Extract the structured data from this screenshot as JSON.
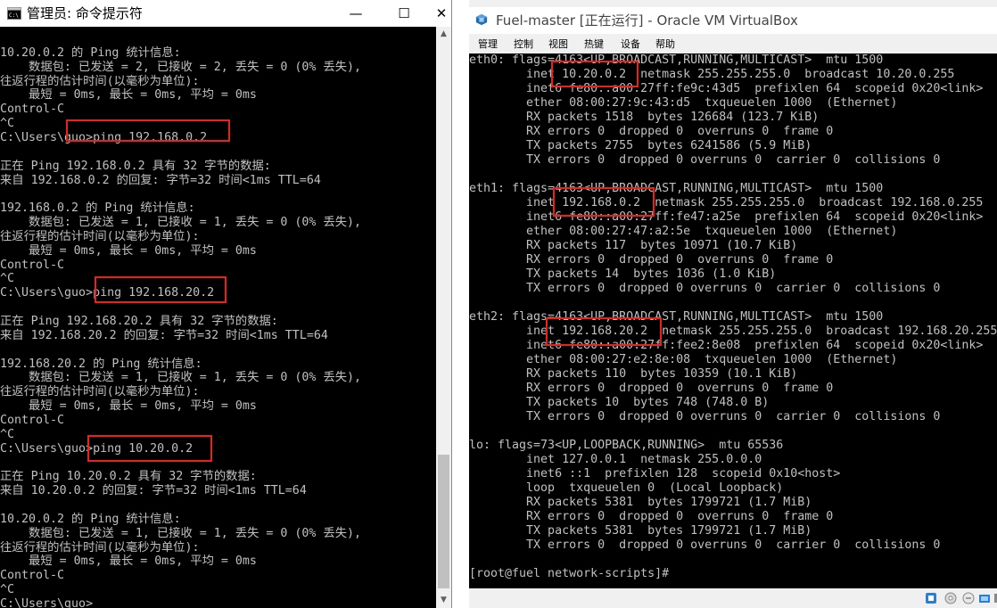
{
  "cmd_window": {
    "title": "管理员: 命令提示符",
    "icon": "cmd-icon",
    "controls": {
      "minimize": "—",
      "maximize": "☐",
      "close": "✕"
    },
    "lines": [
      "",
      "10.20.0.2 的 Ping 统计信息:",
      "    数据包: 已发送 = 2, 已接收 = 2, 丢失 = 0 (0% 丢失),",
      "往返行程的估计时间(以毫秒为单位):",
      "    最短 = 0ms, 最长 = 0ms, 平均 = 0ms",
      "Control-C",
      "^C",
      "C:\\Users\\guo>ping 192.168.0.2",
      "",
      "正在 Ping 192.168.0.2 具有 32 字节的数据:",
      "来自 192.168.0.2 的回复: 字节=32 时间<1ms TTL=64",
      "",
      "192.168.0.2 的 Ping 统计信息:",
      "    数据包: 已发送 = 1, 已接收 = 1, 丢失 = 0 (0% 丢失),",
      "往返行程的估计时间(以毫秒为单位):",
      "    最短 = 0ms, 最长 = 0ms, 平均 = 0ms",
      "Control-C",
      "^C",
      "C:\\Users\\guo>ping 192.168.20.2",
      "",
      "正在 Ping 192.168.20.2 具有 32 字节的数据:",
      "来自 192.168.20.2 的回复: 字节=32 时间<1ms TTL=64",
      "",
      "192.168.20.2 的 Ping 统计信息:",
      "    数据包: 已发送 = 1, 已接收 = 1, 丢失 = 0 (0% 丢失),",
      "往返行程的估计时间(以毫秒为单位):",
      "    最短 = 0ms, 最长 = 0ms, 平均 = 0ms",
      "Control-C",
      "^C",
      "C:\\Users\\guo>ping 10.20.0.2",
      "",
      "正在 Ping 10.20.0.2 具有 32 字节的数据:",
      "来自 10.20.0.2 的回复: 字节=32 时间<1ms TTL=64",
      "",
      "10.20.0.2 的 Ping 统计信息:",
      "    数据包: 已发送 = 1, 已接收 = 1, 丢失 = 0 (0% 丢失),",
      "往返行程的估计时间(以毫秒为单位):",
      "    最短 = 0ms, 最长 = 0ms, 平均 = 0ms",
      "Control-C",
      "^C",
      "C:\\Users\\guo>"
    ]
  },
  "vbox_window": {
    "title": "Fuel-master [正在运行] - Oracle VM VirtualBox",
    "icon": "virtualbox-icon",
    "controls": {
      "minimize": "—",
      "maximize": "☐",
      "close": "✕"
    },
    "menu": [
      "管理",
      "控制",
      "视图",
      "热键",
      "设备",
      "帮助"
    ],
    "lines": [
      "eth0: flags=4163<UP,BROADCAST,RUNNING,MULTICAST>  mtu 1500",
      "        inet 10.20.0.2  netmask 255.255.255.0  broadcast 10.20.0.255",
      "        inet6 fe80::a00:27ff:fe9c:43d5  prefixlen 64  scopeid 0x20<link>",
      "        ether 08:00:27:9c:43:d5  txqueuelen 1000  (Ethernet)",
      "        RX packets 1518  bytes 126684 (123.7 KiB)",
      "        RX errors 0  dropped 0  overruns 0  frame 0",
      "        TX packets 2755  bytes 6241586 (5.9 MiB)",
      "        TX errors 0  dropped 0 overruns 0  carrier 0  collisions 0",
      "",
      "eth1: flags=4163<UP,BROADCAST,RUNNING,MULTICAST>  mtu 1500",
      "        inet 192.168.0.2  netmask 255.255.255.0  broadcast 192.168.0.255",
      "        inet6 fe80::a00:27ff:fe47:a25e  prefixlen 64  scopeid 0x20<link>",
      "        ether 08:00:27:47:a2:5e  txqueuelen 1000  (Ethernet)",
      "        RX packets 117  bytes 10971 (10.7 KiB)",
      "        RX errors 0  dropped 0  overruns 0  frame 0",
      "        TX packets 14  bytes 1036 (1.0 KiB)",
      "        TX errors 0  dropped 0 overruns 0  carrier 0  collisions 0",
      "",
      "eth2: flags=4163<UP,BROADCAST,RUNNING,MULTICAST>  mtu 1500",
      "        inet 192.168.20.2  netmask 255.255.255.0  broadcast 192.168.20.255",
      "        inet6 fe80::a00:27ff:fee2:8e08  prefixlen 64  scopeid 0x20<link>",
      "        ether 08:00:27:e2:8e:08  txqueuelen 1000  (Ethernet)",
      "        RX packets 110  bytes 10359 (10.1 KiB)",
      "        RX errors 0  dropped 0  overruns 0  frame 0",
      "        TX packets 10  bytes 748 (748.0 B)",
      "        TX errors 0  dropped 0 overruns 0  carrier 0  collisions 0",
      "",
      "lo: flags=73<UP,LOOPBACK,RUNNING>  mtu 65536",
      "        inet 127.0.0.1  netmask 255.0.0.0",
      "        inet6 ::1  prefixlen 128  scopeid 0x10<host>",
      "        loop  txqueuelen 0  (Local Loopback)",
      "        RX packets 5381  bytes 1799721 (1.7 MiB)",
      "        RX errors 0  dropped 0  overruns 0  frame 0",
      "        TX packets 5381  bytes 1799721 (1.7 MiB)",
      "        TX errors 0  dropped 0 overruns 0  carrier 0  collisions 0",
      "",
      "[root@fuel network-scripts]#"
    ],
    "status_icons": [
      "network-icon",
      "cd-icon",
      "usb-icon",
      "shared-folder-icon",
      "keyboard-icon"
    ]
  },
  "colors": {
    "highlight": "#e8221c",
    "console_bg": "#000000",
    "console_text": "#c0c0c0"
  }
}
